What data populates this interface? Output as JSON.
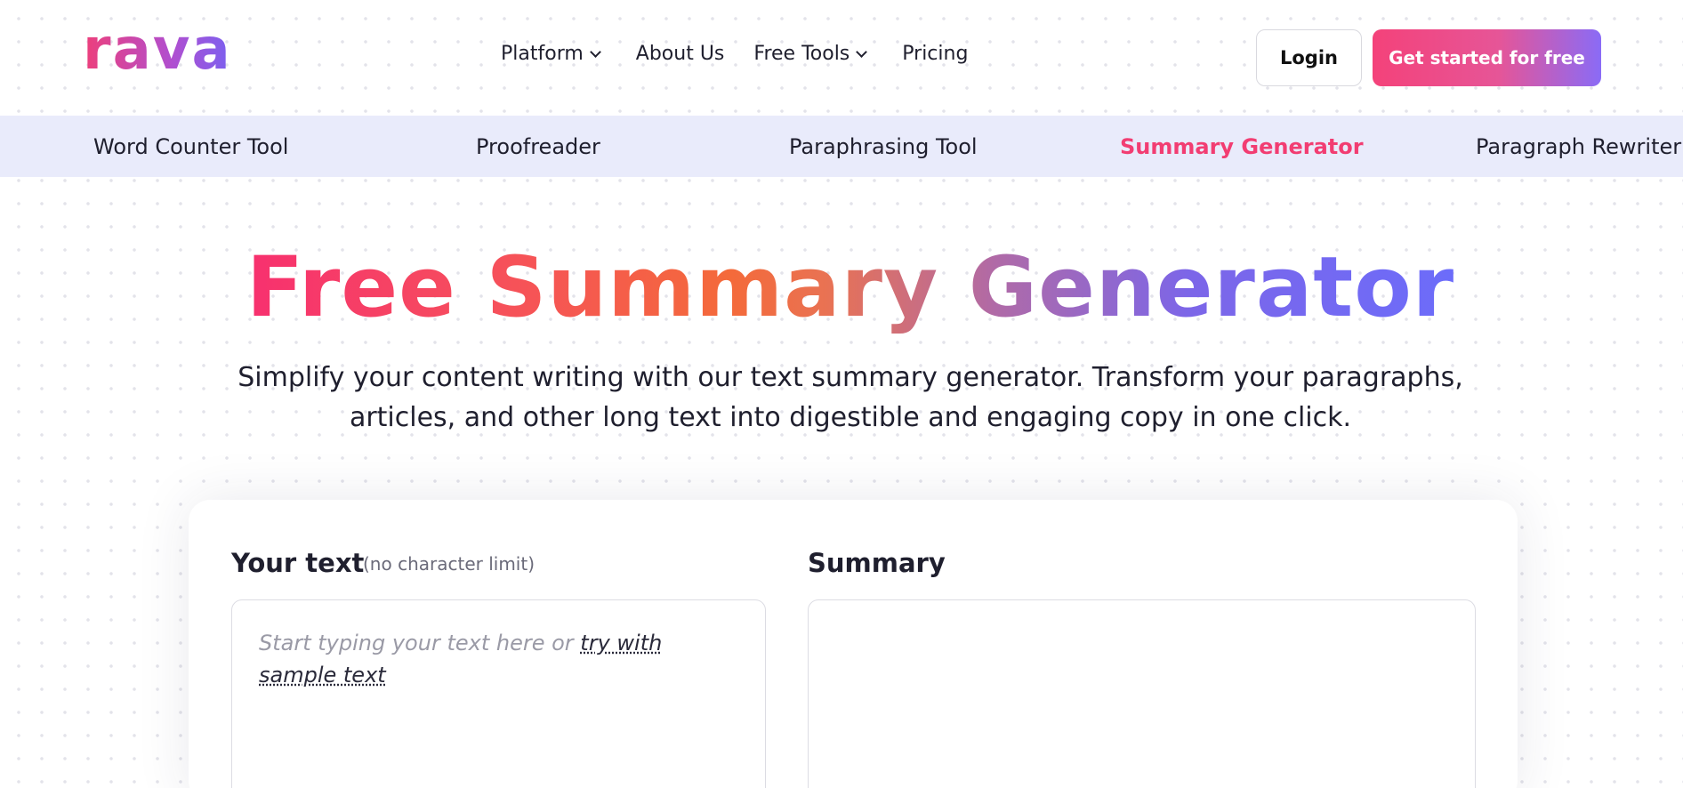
{
  "header": {
    "logo": "rava",
    "nav": [
      {
        "label": "Platform",
        "dropdown": true
      },
      {
        "label": "About Us",
        "dropdown": false
      },
      {
        "label": "Free Tools",
        "dropdown": true
      },
      {
        "label": "Pricing",
        "dropdown": false
      }
    ],
    "login_label": "Login",
    "cta_label": "Get started for free"
  },
  "tools": [
    {
      "label": "Word Counter Tool",
      "active": false
    },
    {
      "label": "Proofreader",
      "active": false
    },
    {
      "label": "Paraphrasing Tool",
      "active": false
    },
    {
      "label": "Summary Generator",
      "active": true
    },
    {
      "label": "Paragraph Rewriter",
      "active": false
    }
  ],
  "hero": {
    "title": "Free Summary Generator",
    "subtitle": "Simplify your content writing with our text summary generator. Transform your paragraphs, articles, and other long text into digestible and engaging copy in one click."
  },
  "editor": {
    "input_label": "Your text",
    "input_note": "(no character limit)",
    "placeholder_prefix": "Start typing your text here or",
    "sample_link": "try with sample text",
    "output_label": "Summary",
    "output_value": ""
  },
  "colors": {
    "accent_pink": "#f23d72",
    "accent_purple": "#6c6cfa",
    "tool_bar_bg": "#e9ebfb"
  }
}
